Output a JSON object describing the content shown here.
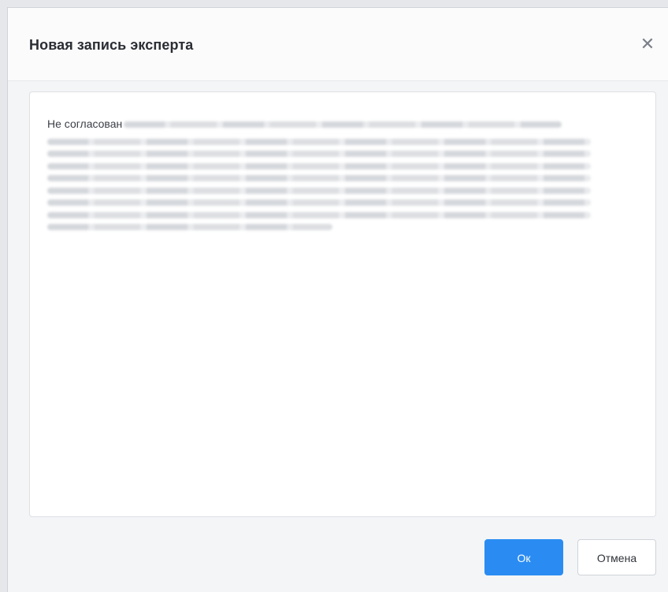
{
  "dialog": {
    "title": "Новая запись эксперта",
    "close_icon": "close-icon",
    "content": {
      "visible_text": "Не согласован",
      "blurred": true
    },
    "buttons": {
      "ok_label": "Ок",
      "cancel_label": "Отмена"
    }
  },
  "colors": {
    "primary": "#2a8cf2",
    "background": "#f4f5f7",
    "header_bg": "#fbfbfc",
    "text": "#2a2d33"
  }
}
